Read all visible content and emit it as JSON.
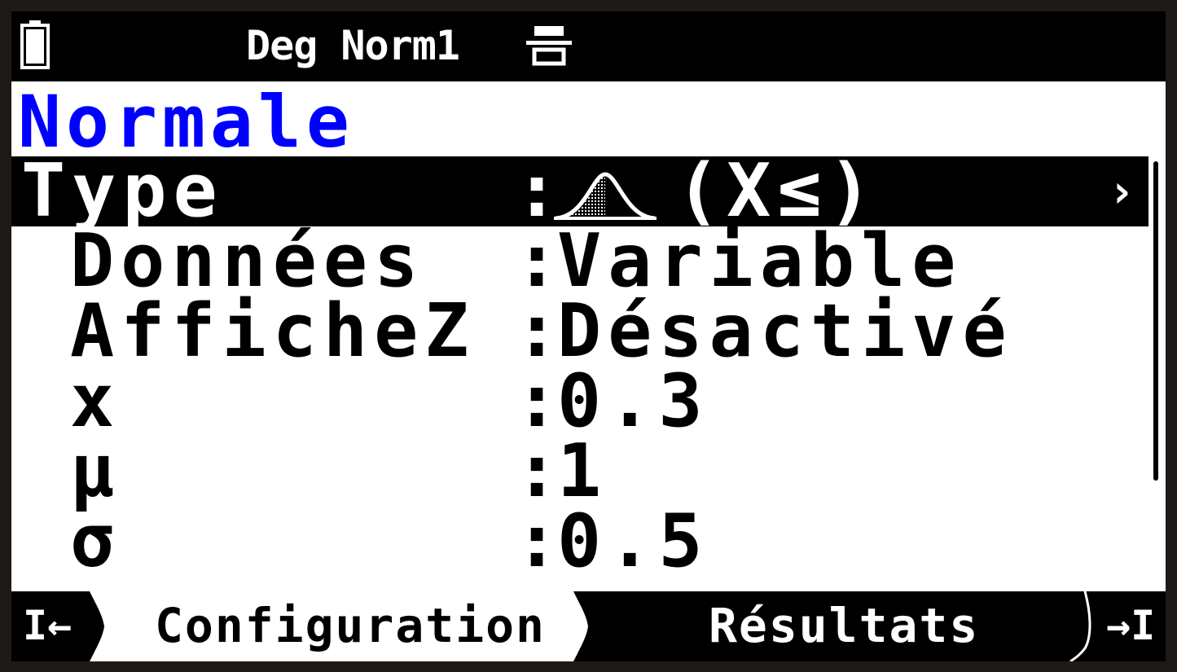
{
  "status": {
    "battery_icon": "battery-icon",
    "text": "Deg Norm1",
    "separator_icon": "display-separator-icon"
  },
  "title": "Normale",
  "params": [
    {
      "label": "Type",
      "value": "(X≤)",
      "icon": "normal-distribution-curve-icon",
      "selected": true
    },
    {
      "label": "Données",
      "value": "Variable"
    },
    {
      "label": "AfficheZ",
      "value": "Désactivé"
    },
    {
      "label": "x",
      "value": "0.3"
    },
    {
      "label": "μ",
      "value": "1"
    },
    {
      "label": "σ",
      "value": "0.5"
    }
  ],
  "colon": ":",
  "chevron": "›",
  "tabs": {
    "first": "I←",
    "config": "Configuration",
    "results": "Résultats",
    "last": "→I"
  },
  "colors": {
    "title": "#0000ff",
    "bar": "#000000",
    "screen": "#ffffff"
  }
}
